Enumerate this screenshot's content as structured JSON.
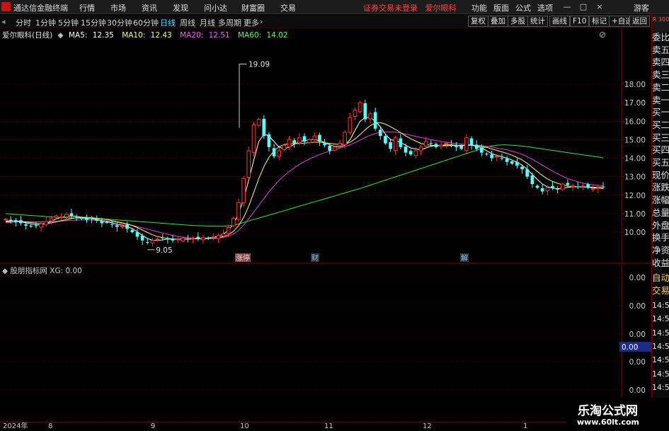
{
  "app": {
    "title": "通达信金融终端",
    "logo_color": "#c81414"
  },
  "menu": [
    "行情",
    "市场",
    "资讯",
    "发现",
    "问小达",
    "财富圈",
    "交易"
  ],
  "status_message": "证券交易未登录",
  "stock_link": "爱尔眼科",
  "right_menu": [
    "功能",
    "版面",
    "公式",
    "选项"
  ],
  "window_buttons": {
    "minimize": "—",
    "maximize": "□",
    "close": "×"
  },
  "guest_label": "游客",
  "period_tabs": [
    "分时",
    "1分钟",
    "5分钟",
    "15分钟",
    "30分钟",
    "60分钟",
    "日线",
    "周线",
    "月线",
    "多周期",
    "更多"
  ],
  "active_period": "日线",
  "toolbar_buttons": [
    "复权",
    "叠加",
    "多股",
    "统计",
    "画线",
    "F10",
    "标记",
    "+自选",
    "返回"
  ],
  "side_panel": {
    "top_label": "R 300",
    "labels": [
      "委比",
      "卖五",
      "卖四",
      "卖三",
      "卖二",
      "卖一",
      "买一",
      "买二",
      "买三",
      "买四",
      "买五",
      "现价",
      "涨跌",
      "涨幅",
      "总量",
      "外盘",
      "换手",
      "净资",
      "收益",
      "自动",
      "交易"
    ],
    "times": [
      "14:56",
      "14:56",
      "14:56",
      "14:56",
      "14:56",
      "14:56",
      "14:56",
      "14:56",
      "14:56"
    ]
  },
  "main_chart": {
    "stock_name": "爱尔眼科(日线)",
    "ma_legend": [
      {
        "label": "MA5:",
        "value": "12.35",
        "color": "#ffffff"
      },
      {
        "label": "MA10:",
        "value": "12.43",
        "color": "#ffff55"
      },
      {
        "label": "MA20:",
        "value": "12.51",
        "color": "#ff55ff"
      },
      {
        "label": "MA60:",
        "value": "14.02",
        "color": "#55ff55"
      }
    ],
    "annotations": {
      "high": "19.09",
      "low": "9.05"
    },
    "event_markers": [
      "涨停",
      "财",
      "解"
    ]
  },
  "indicator_panel": {
    "name": "股朋指标网",
    "label": "XG:",
    "value": "0.00",
    "highlight_value": "0.00"
  },
  "date_axis": [
    "2024年",
    "8",
    "9",
    "10",
    "11",
    "12",
    "1"
  ],
  "watermark": {
    "title": "乐淘公式网",
    "url": "www.60lt.com"
  },
  "colors": {
    "up": "#ff3232",
    "down": "#54ffff",
    "grid": "#8b0000",
    "axis_text": "#c8c8c8"
  },
  "chart_data": {
    "type": "candlestick",
    "title": "爱尔眼科(日线)",
    "y_axis_ticks": [
      10.0,
      11.0,
      12.0,
      13.0,
      14.0,
      15.0,
      16.0,
      17.0,
      18.0
    ],
    "ylim": [
      9.0,
      19.2
    ],
    "x_axis_labels": [
      "2024年",
      "8",
      "9",
      "10",
      "11",
      "12",
      "1"
    ],
    "ma_legend": {
      "MA5": 12.35,
      "MA10": 12.43,
      "MA20": 12.51,
      "MA60": 14.02
    },
    "annotated_high": 19.09,
    "annotated_low": 9.05,
    "close": [
      10.7,
      10.62,
      10.55,
      10.48,
      10.35,
      10.3,
      10.36,
      10.45,
      10.58,
      10.72,
      10.88,
      10.82,
      10.96,
      10.9,
      10.8,
      10.72,
      10.66,
      10.72,
      10.62,
      10.48,
      10.52,
      10.4,
      10.28,
      10.32,
      10.18,
      10.0,
      9.75,
      9.55,
      9.45,
      9.55,
      9.62,
      9.7,
      9.62,
      9.55,
      9.62,
      9.68,
      9.6,
      9.66,
      9.64,
      9.7,
      9.66,
      9.74,
      9.82,
      9.9,
      10.25,
      10.75,
      11.6,
      12.9,
      14.4,
      15.8,
      16.1,
      15.2,
      14.6,
      14.1,
      14.4,
      14.7,
      15.0,
      14.8,
      15.1,
      14.9,
      15.0,
      15.2,
      14.9,
      14.7,
      14.4,
      14.6,
      14.8,
      15.4,
      16.2,
      16.6,
      17.0,
      16.1,
      16.4,
      15.6,
      15.2,
      14.8,
      14.5,
      15.1,
      14.6,
      14.3,
      14.2,
      14.4,
      14.6,
      14.9,
      14.8,
      14.6,
      14.7,
      14.8,
      14.7,
      14.6,
      14.5,
      15.1,
      14.7,
      14.5,
      14.3,
      14.2,
      14.0,
      14.1,
      14.0,
      13.8,
      13.7,
      13.6,
      13.4,
      13.0,
      12.6,
      12.4,
      12.2,
      12.4,
      12.4,
      12.3,
      12.6,
      12.55,
      12.5,
      12.45,
      12.5,
      12.4,
      12.35,
      12.4,
      12.45
    ],
    "ma5": [
      10.55,
      10.58,
      10.6,
      10.57,
      10.5,
      10.45,
      10.4,
      10.4,
      10.47,
      10.58,
      10.72,
      10.8,
      10.86,
      10.88,
      10.85,
      10.8,
      10.75,
      10.72,
      10.68,
      10.62,
      10.56,
      10.5,
      10.42,
      10.38,
      10.3,
      10.2,
      10.02,
      9.82,
      9.65,
      9.56,
      9.55,
      9.58,
      9.62,
      9.62,
      9.62,
      9.64,
      9.63,
      9.64,
      9.65,
      9.66,
      9.68,
      9.72,
      9.78,
      9.9,
      10.1,
      10.45,
      11.0,
      11.8,
      12.8,
      13.9,
      14.9,
      15.3,
      15.2,
      14.9,
      14.6,
      14.5,
      14.6,
      14.75,
      14.9,
      14.95,
      15.0,
      15.0,
      14.95,
      14.85,
      14.72,
      14.64,
      14.6,
      14.7,
      15.0,
      15.5,
      16.0,
      16.2,
      16.2,
      16.0,
      15.7,
      15.3,
      15.0,
      14.95,
      14.85,
      14.7,
      14.55,
      14.5,
      14.45,
      14.55,
      14.65,
      14.68,
      14.7,
      14.72,
      14.72,
      14.7,
      14.65,
      14.72,
      14.7,
      14.65,
      14.55,
      14.4,
      14.25,
      14.15,
      14.08,
      14.0,
      13.9,
      13.78,
      13.62,
      13.4,
      13.12,
      12.85,
      12.6,
      12.45,
      12.38,
      12.35,
      12.38,
      12.42,
      12.45,
      12.45,
      12.45,
      12.42,
      12.4,
      12.38,
      12.35
    ],
    "ma10": [
      10.6,
      10.6,
      10.6,
      10.58,
      10.55,
      10.52,
      10.48,
      10.46,
      10.46,
      10.5,
      10.56,
      10.62,
      10.68,
      10.74,
      10.78,
      10.8,
      10.8,
      10.78,
      10.75,
      10.72,
      10.68,
      10.62,
      10.56,
      10.5,
      10.44,
      10.36,
      10.25,
      10.12,
      9.98,
      9.86,
      9.76,
      9.7,
      9.66,
      9.63,
      9.62,
      9.62,
      9.62,
      9.63,
      9.64,
      9.65,
      9.66,
      9.68,
      9.7,
      9.76,
      9.86,
      10.05,
      10.35,
      10.8,
      11.4,
      12.15,
      12.9,
      13.55,
      14.05,
      14.4,
      14.62,
      14.74,
      14.78,
      14.78,
      14.8,
      14.82,
      14.84,
      14.86,
      14.86,
      14.84,
      14.8,
      14.76,
      14.74,
      14.76,
      14.86,
      15.04,
      15.28,
      15.54,
      15.76,
      15.9,
      15.92,
      15.84,
      15.7,
      15.55,
      15.38,
      15.2,
      15.05,
      14.92,
      14.8,
      14.74,
      14.7,
      14.68,
      14.67,
      14.67,
      14.68,
      14.69,
      14.69,
      14.7,
      14.7,
      14.68,
      14.64,
      14.58,
      14.5,
      14.42,
      14.34,
      14.26,
      14.16,
      14.04,
      13.9,
      13.72,
      13.5,
      13.28,
      13.06,
      12.88,
      12.74,
      12.64,
      12.56,
      12.5,
      12.47,
      12.45,
      12.44,
      12.44,
      12.43,
      12.43,
      12.43
    ],
    "ma20": [
      10.5,
      10.52,
      10.54,
      10.55,
      10.56,
      10.56,
      10.56,
      10.56,
      10.56,
      10.57,
      10.58,
      10.6,
      10.62,
      10.64,
      10.65,
      10.66,
      10.66,
      10.65,
      10.64,
      10.62,
      10.6,
      10.56,
      10.52,
      10.47,
      10.42,
      10.36,
      10.3,
      10.23,
      10.16,
      10.09,
      10.02,
      9.95,
      9.88,
      9.82,
      9.77,
      9.73,
      9.7,
      9.68,
      9.66,
      9.65,
      9.65,
      9.66,
      9.68,
      9.72,
      9.78,
      9.9,
      10.1,
      10.38,
      10.72,
      11.08,
      11.45,
      11.82,
      12.18,
      12.5,
      12.8,
      13.05,
      13.28,
      13.48,
      13.66,
      13.82,
      13.96,
      14.08,
      14.2,
      14.3,
      14.38,
      14.46,
      14.54,
      14.62,
      14.72,
      14.84,
      14.98,
      15.12,
      15.24,
      15.34,
      15.4,
      15.42,
      15.42,
      15.4,
      15.36,
      15.3,
      15.24,
      15.18,
      15.12,
      15.06,
      15.0,
      14.95,
      14.9,
      14.86,
      14.82,
      14.79,
      14.76,
      14.74,
      14.72,
      14.7,
      14.67,
      14.64,
      14.6,
      14.55,
      14.5,
      14.45,
      14.38,
      14.3,
      14.2,
      14.08,
      13.94,
      13.78,
      13.62,
      13.46,
      13.3,
      13.15,
      13.02,
      12.9,
      12.8,
      12.72,
      12.65,
      12.6,
      12.56,
      12.53,
      12.51
    ],
    "ma60": [
      11.0,
      10.98,
      10.96,
      10.94,
      10.92,
      10.9,
      10.88,
      10.86,
      10.84,
      10.82,
      10.8,
      10.79,
      10.78,
      10.77,
      10.76,
      10.75,
      10.74,
      10.73,
      10.72,
      10.71,
      10.7,
      10.68,
      10.66,
      10.64,
      10.62,
      10.6,
      10.58,
      10.56,
      10.54,
      10.52,
      10.5,
      10.48,
      10.46,
      10.44,
      10.42,
      10.4,
      10.38,
      10.36,
      10.35,
      10.34,
      10.33,
      10.32,
      10.32,
      10.32,
      10.34,
      10.38,
      10.44,
      10.52,
      10.6,
      10.68,
      10.76,
      10.84,
      10.92,
      11.0,
      11.08,
      11.16,
      11.24,
      11.32,
      11.4,
      11.48,
      11.56,
      11.64,
      11.72,
      11.8,
      11.88,
      11.96,
      12.04,
      12.12,
      12.2,
      12.28,
      12.36,
      12.45,
      12.54,
      12.63,
      12.72,
      12.81,
      12.9,
      12.99,
      13.08,
      13.17,
      13.26,
      13.35,
      13.44,
      13.53,
      13.62,
      13.71,
      13.8,
      13.89,
      13.98,
      14.07,
      14.16,
      14.25,
      14.34,
      14.43,
      14.52,
      14.6,
      14.66,
      14.7,
      14.72,
      14.72,
      14.7,
      14.68,
      14.65,
      14.62,
      14.58,
      14.54,
      14.5,
      14.46,
      14.42,
      14.38,
      14.34,
      14.3,
      14.26,
      14.22,
      14.18,
      14.14,
      14.1,
      14.06,
      14.02
    ],
    "indicator": {
      "name": "股朋指标网",
      "XG": 0.0,
      "y_axis_ticks": [
        0.0,
        0.0,
        0.0,
        0.0,
        0.0,
        0.0
      ]
    }
  }
}
